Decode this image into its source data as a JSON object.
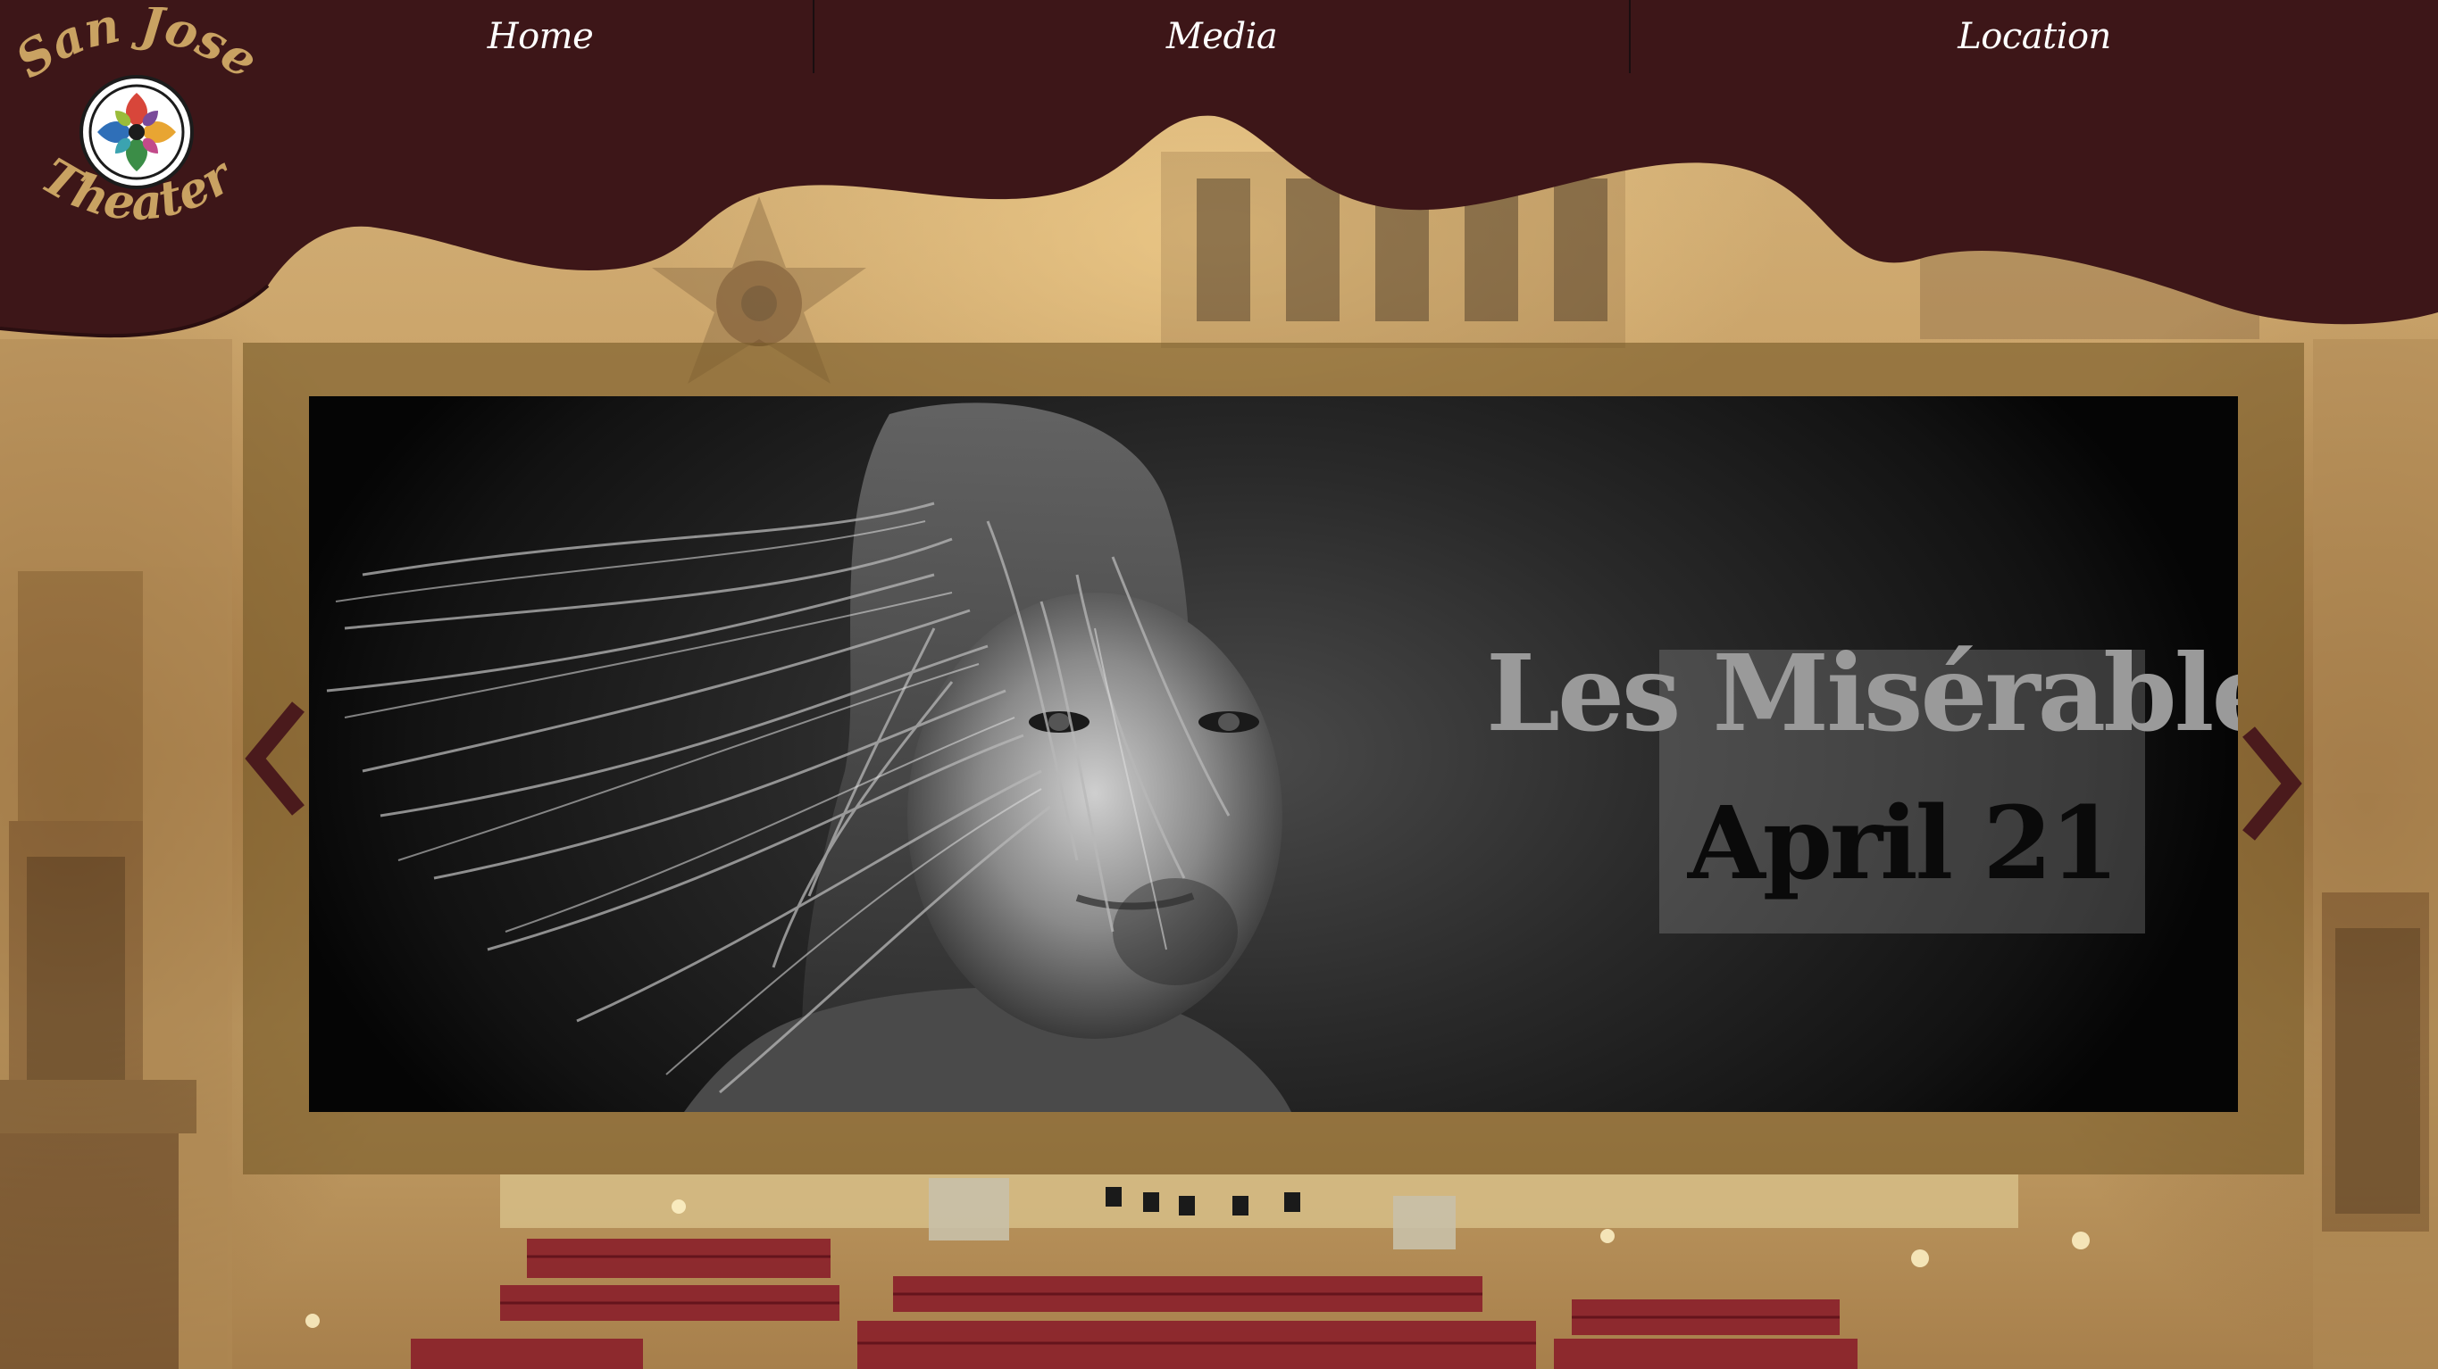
{
  "logo": {
    "line1": "San Jose",
    "line2": "Theater"
  },
  "nav": {
    "items": [
      {
        "label": "Home"
      },
      {
        "label": "Media"
      },
      {
        "label": "Location"
      }
    ]
  },
  "carousel": {
    "slide": {
      "title": "Les Misérables",
      "date": "April 21"
    },
    "prev_icon": "chevron-left-icon",
    "next_icon": "chevron-right-icon"
  },
  "colors": {
    "curtain": "#3d1618",
    "logo_gold": "#c9a262",
    "carousel_frame": "#785a28",
    "arrow": "#4a1a1c"
  }
}
